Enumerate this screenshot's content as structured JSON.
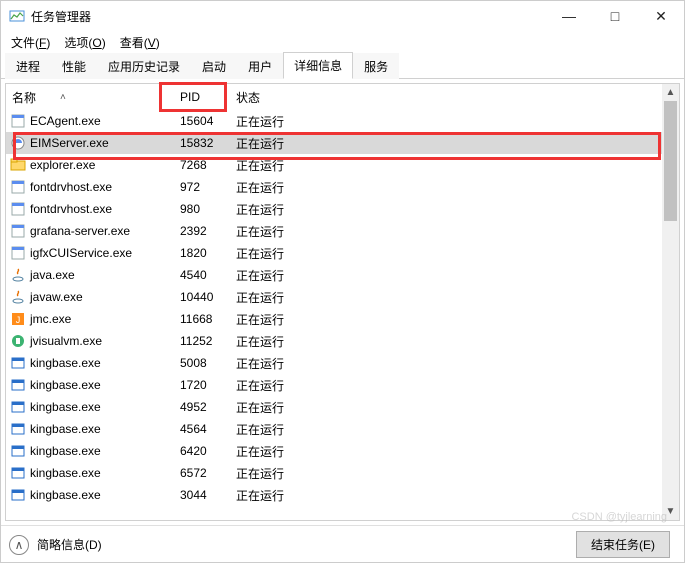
{
  "window": {
    "title": "任务管理器"
  },
  "menu": [
    "文件(F)",
    "选项(O)",
    "查看(V)"
  ],
  "tabs": [
    "进程",
    "性能",
    "应用历史记录",
    "启动",
    "用户",
    "详细信息",
    "服务"
  ],
  "active_tab": "详细信息",
  "columns": {
    "name": "名称",
    "pid": "PID",
    "status": "状态"
  },
  "selected_pid": 15832,
  "processes": [
    {
      "name": "ECAgent.exe",
      "pid": 15604,
      "status": "正在运行",
      "icon": "generic"
    },
    {
      "name": "EIMServer.exe",
      "pid": 15832,
      "status": "正在运行",
      "icon": "eim"
    },
    {
      "name": "explorer.exe",
      "pid": 7268,
      "status": "正在运行",
      "icon": "explorer"
    },
    {
      "name": "fontdrvhost.exe",
      "pid": 972,
      "status": "正在运行",
      "icon": "generic"
    },
    {
      "name": "fontdrvhost.exe",
      "pid": 980,
      "status": "正在运行",
      "icon": "generic"
    },
    {
      "name": "grafana-server.exe",
      "pid": 2392,
      "status": "正在运行",
      "icon": "generic"
    },
    {
      "name": "igfxCUIService.exe",
      "pid": 1820,
      "status": "正在运行",
      "icon": "generic"
    },
    {
      "name": "java.exe",
      "pid": 4540,
      "status": "正在运行",
      "icon": "java"
    },
    {
      "name": "javaw.exe",
      "pid": 10440,
      "status": "正在运行",
      "icon": "java"
    },
    {
      "name": "jmc.exe",
      "pid": 11668,
      "status": "正在运行",
      "icon": "jmc"
    },
    {
      "name": "jvisualvm.exe",
      "pid": 11252,
      "status": "正在运行",
      "icon": "jvisualvm"
    },
    {
      "name": "kingbase.exe",
      "pid": 5008,
      "status": "正在运行",
      "icon": "kingbase"
    },
    {
      "name": "kingbase.exe",
      "pid": 1720,
      "status": "正在运行",
      "icon": "kingbase"
    },
    {
      "name": "kingbase.exe",
      "pid": 4952,
      "status": "正在运行",
      "icon": "kingbase"
    },
    {
      "name": "kingbase.exe",
      "pid": 4564,
      "status": "正在运行",
      "icon": "kingbase"
    },
    {
      "name": "kingbase.exe",
      "pid": 6420,
      "status": "正在运行",
      "icon": "kingbase"
    },
    {
      "name": "kingbase.exe",
      "pid": 6572,
      "status": "正在运行",
      "icon": "kingbase"
    },
    {
      "name": "kingbase.exe",
      "pid": 3044,
      "status": "正在运行",
      "icon": "kingbase"
    }
  ],
  "bottom": {
    "fewer_details": "简略信息(D)",
    "end_task": "结束任务(E)"
  },
  "watermark": "CSDN @tyjlearning"
}
